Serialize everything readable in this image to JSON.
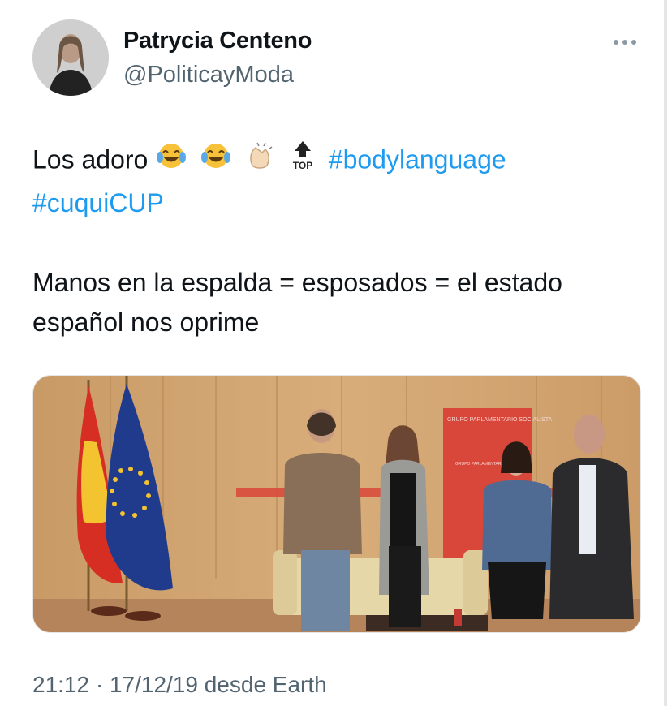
{
  "author": {
    "name": "Patrycia Centeno",
    "handle": "@PoliticayModa"
  },
  "tweet": {
    "line1_text": "Los adoro",
    "emoji_1": "joy-emoji",
    "emoji_2": "joy-emoji",
    "emoji_3": "clapping-hands-emoji",
    "emoji_4": "top-arrow-emoji",
    "hashtag_1": "#bodylanguage",
    "hashtag_2": "#cuquiCUP",
    "paragraph_line1": "Manos en la espalda = esposados = el estado",
    "paragraph_line2": "español nos oprime"
  },
  "photo": {
    "banner_text": "GRUPO PARLAMENTARIO SOCIALISTA",
    "banner_sub_text": "GRUPO PARLAMENTARIO SOCIALISTA"
  },
  "meta": {
    "timestamp": "21:12 · 17/12/19 desde Earth"
  },
  "colors": {
    "hashtag": "#1d9bf0",
    "secondary_text": "#536471",
    "background": "#ffffff"
  }
}
